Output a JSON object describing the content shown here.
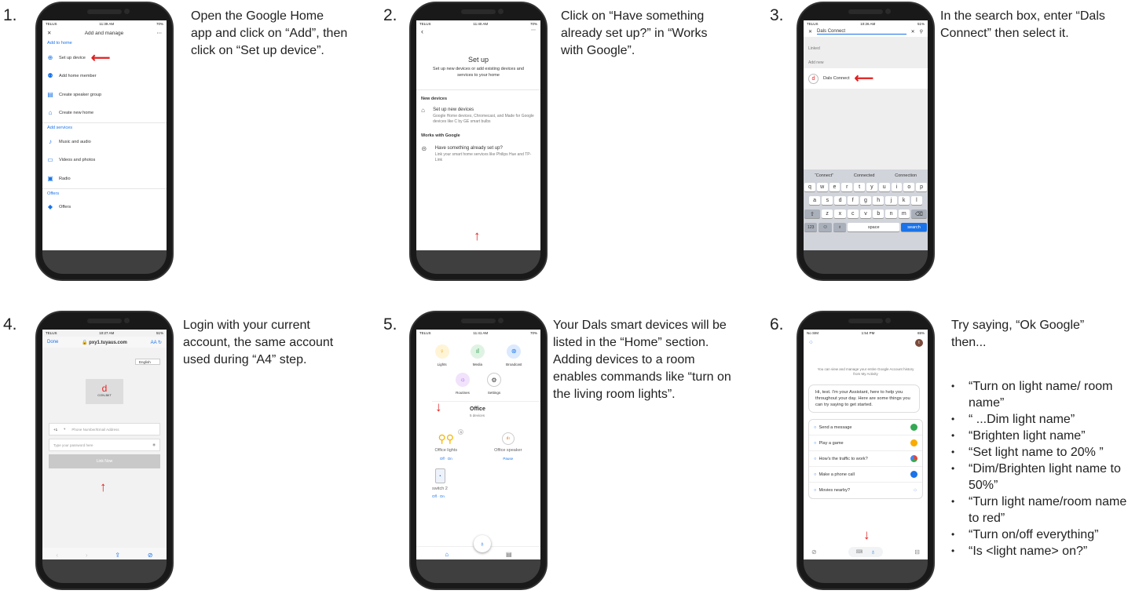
{
  "steps": [
    {
      "num": "1.",
      "text": "Open the Google Home app and click on “Add”, then click on “Set up device”."
    },
    {
      "num": "2.",
      "text": "Click on “Have something already set up?” in “Works with Google”."
    },
    {
      "num": "3.",
      "text": "In the search box, enter “Dals Connect” then select it."
    },
    {
      "num": "4.",
      "text": "Login with your current account, the same account used during “A4” step."
    },
    {
      "num": "5.",
      "text": "Your Dals smart devices will be listed in the “Home” section. Adding devices to a room enables commands like “turn on the living room lights”."
    },
    {
      "num": "6.",
      "text": "Try saying, “Ok Google” then..."
    }
  ],
  "commands": [
    "“Turn on light name/ room name”",
    "“ ...Dim light name”",
    "“Brighten light name”",
    "“Set light name to 20% ”",
    "“Dim/Brighten light name to 50%”",
    "“Turn light name/room name to red”",
    "“Turn on/off everything”",
    "“Is <light name> on?”"
  ],
  "phone1": {
    "carrier": "TELUS",
    "time": "11:39 AM",
    "battery": "70%",
    "title": "Add and manage",
    "sec_home": "Add to home",
    "items_home": [
      "Set up device",
      "Add home member",
      "Create speaker group",
      "Create new home"
    ],
    "sec_services": "Add services",
    "items_services": [
      "Music and audio",
      "Videos and photos",
      "Radio"
    ],
    "sec_offers": "Offers",
    "items_offers": [
      "Offers"
    ]
  },
  "phone2": {
    "carrier": "TELUS",
    "time": "11:40 AM",
    "battery": "70%",
    "title": "Set up",
    "subtitle": "Set up new devices or add existing devices and services to your home",
    "sec_new": "New devices",
    "new_title": "Set up new devices",
    "new_desc": "Google Home devices, Chromecast, and Made for Google devices like C by GE smart bulbs",
    "sec_works": "Works with Google",
    "works_title": "Have something already set up?",
    "works_desc": "Link your smart home services like Philips Hue and TP-Link"
  },
  "phone3": {
    "carrier": "TELUS",
    "time": "10:26 AM",
    "battery": "51%",
    "search": "Dals Connect",
    "linked": "Linked",
    "addnew": "Add new",
    "result": "Dals Connect",
    "suggest": [
      "“Connect”",
      "Connected",
      "Connection"
    ],
    "row1": [
      "q",
      "w",
      "e",
      "r",
      "t",
      "y",
      "u",
      "i",
      "o",
      "p"
    ],
    "row2": [
      "a",
      "s",
      "d",
      "f",
      "g",
      "h",
      "j",
      "k",
      "l"
    ],
    "row3": [
      "z",
      "x",
      "c",
      "v",
      "b",
      "n",
      "m"
    ],
    "k123": "123",
    "space": "space",
    "searchkey": "search"
  },
  "phone4": {
    "carrier": "TELUS",
    "time": "10:27 AM",
    "battery": "51%",
    "done": "Done",
    "url": "pxy1.tuyaus.com",
    "aa": "AA",
    "lang": "English",
    "logo": "CON-BIIT",
    "code": "+1",
    "phone_ph": "Phone Number/Email Address",
    "pass_ph": "Type your password here",
    "link": "Link Now"
  },
  "phone5": {
    "carrier": "TELUS",
    "time": "11:41 AM",
    "battery": "70%",
    "shortcuts": [
      "Lights",
      "Media",
      "Broadcast"
    ],
    "shortcuts2": [
      "Routines",
      "Settings"
    ],
    "room": "Office",
    "room_count": "5 devices",
    "dev1": "Office lights",
    "dev1_badge": "3",
    "dev2": "Office speaker",
    "dev1_off": "Off",
    "dev1_on": "On",
    "dev2_action": "Pause",
    "dev3": "switch 2",
    "dev3_off": "Off",
    "dev3_on": "On"
  },
  "phone6": {
    "carrier": "No SIM",
    "time": "1:54 PM",
    "battery": "65%",
    "avatar": "t",
    "history": "You can view and manage your entire Google Account history from My Activity",
    "greeting": "Hi, test. I'm your Assistant, here to help you throughout your day. Here are some things you can try saying to get started.",
    "suggestions": [
      "Send a message",
      "Play a game",
      "How's the traffic to work?",
      "Make a phone call",
      "Movies nearby?"
    ]
  },
  "colors": {
    "accent": "#1a73e8",
    "arrow": "#e02020",
    "phone_body": "#191919"
  }
}
